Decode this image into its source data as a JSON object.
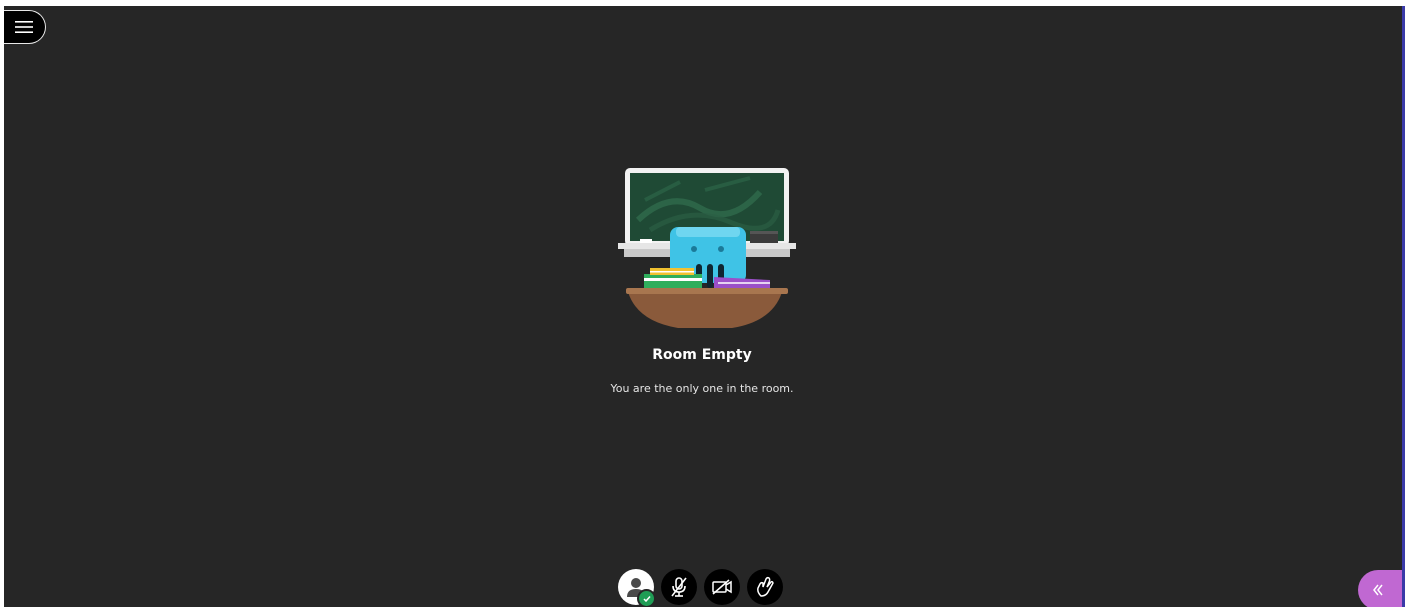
{
  "room": {
    "title": "Room Empty",
    "subtitle": "You are the only one in the room."
  },
  "menu": {
    "icon": "hamburger-menu-icon"
  },
  "controls": [
    {
      "name": "my-status-avatar",
      "icon": "user-avatar-icon",
      "status": "available"
    },
    {
      "name": "microphone",
      "icon": "microphone-muted-icon"
    },
    {
      "name": "camera",
      "icon": "camera-off-icon"
    },
    {
      "name": "raise-hand",
      "icon": "raise-hand-icon"
    }
  ],
  "collaborate_panel": {
    "icon": "double-chevron-left-icon"
  },
  "colors": {
    "background": "#262626",
    "panel_toggle": "#c068d2",
    "status_available": "#1f9d55"
  }
}
